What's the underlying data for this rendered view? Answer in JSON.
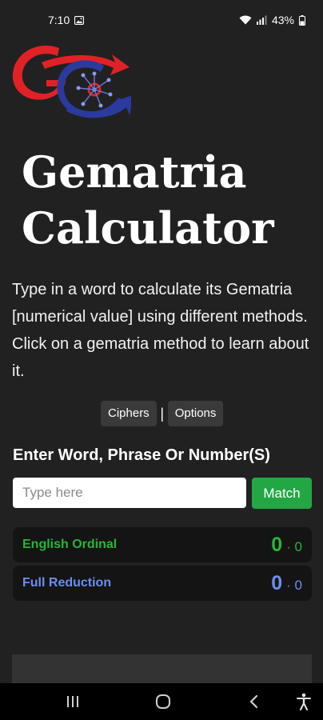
{
  "status_bar": {
    "time": "7:10",
    "battery": "43%",
    "icons": [
      "gallery-icon",
      "wifi-icon",
      "signal-icon",
      "battery-icon"
    ]
  },
  "header": {
    "logo_text": "GC",
    "title_line1": "Gematria",
    "title_line2": "Calculator"
  },
  "intro": {
    "text": "Type in a word to calculate its Gematria [numerical value] using different methods. Click on a gematria method to learn about it."
  },
  "tabs": {
    "ciphers": "Ciphers",
    "separator": "|",
    "options": "Options"
  },
  "input": {
    "label": "Enter Word, Phrase Or Number(S)",
    "placeholder": "Type here",
    "value": "",
    "button": "Match"
  },
  "ciphers": [
    {
      "name": "English Ordinal",
      "total": "0",
      "dot": "·",
      "sub": "0",
      "color": "#27b534"
    },
    {
      "name": "Full Reduction",
      "total": "0",
      "dot": "·",
      "sub": "0",
      "color": "#6b8ff0"
    }
  ],
  "nav": {
    "icons": [
      "recent-apps-icon",
      "home-icon",
      "back-icon",
      "accessibility-icon"
    ]
  }
}
